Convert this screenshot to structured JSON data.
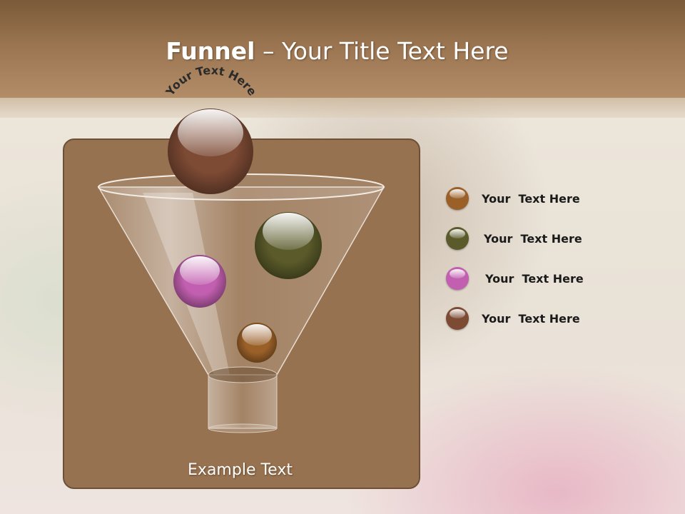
{
  "slide": {
    "title_bold": "Funnel",
    "title_rest": " – Your Title Text Here"
  },
  "funnel": {
    "arc_label": "Your Text Here",
    "caption": "Example Text",
    "balls": [
      {
        "name": "top-ball",
        "color": "#7d4a34"
      },
      {
        "name": "green-ball",
        "color": "#5a5a2a"
      },
      {
        "name": "pink-ball",
        "color": "#c25fb0"
      },
      {
        "name": "orange-ball",
        "color": "#9a6028"
      }
    ]
  },
  "legend": {
    "items": [
      {
        "label": "Your  Text Here",
        "color": "#9a6028"
      },
      {
        "label": "Your  Text Here",
        "color": "#5a5a2a"
      },
      {
        "label": "Your  Text Here",
        "color": "#c25fb0"
      },
      {
        "label": "Your  Text Here",
        "color": "#7d4a34"
      }
    ]
  }
}
